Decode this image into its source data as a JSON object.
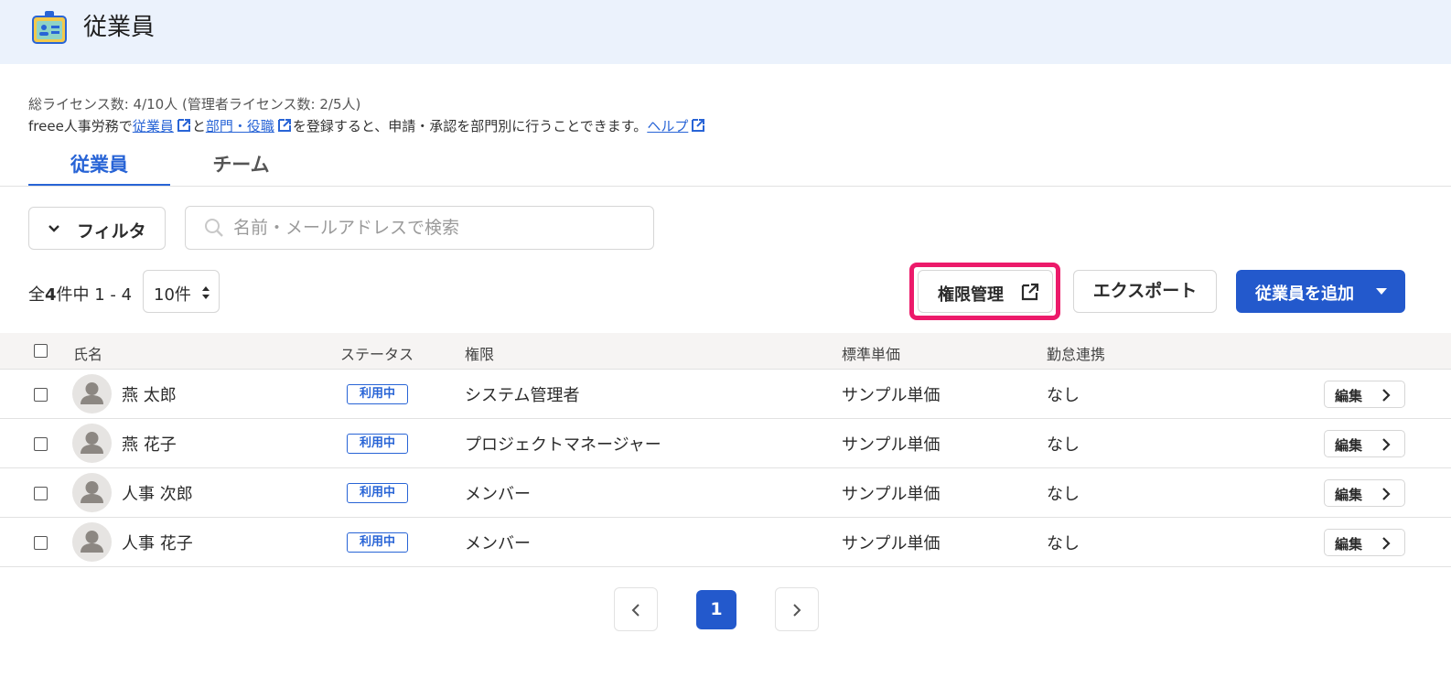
{
  "header": {
    "title": "従業員",
    "icon": "id-badge-icon"
  },
  "info": {
    "license": "総ライセンス数: 4/10人 (管理者ライセンス数: 2/5人)",
    "prefix": "freee人事労務で",
    "link_employees": "従業員",
    "conj": "と",
    "link_departments": "部門・役職",
    "suffix": "を登録すると、申請・承認を部門別に行うことできます。",
    "link_help": "ヘルプ"
  },
  "tabs": [
    {
      "label": "従業員",
      "active": true
    },
    {
      "label": "チーム",
      "active": false
    }
  ],
  "toolbar": {
    "filter_label": "フィルタ",
    "search_placeholder": "名前・メールアドレスで検索",
    "count_prefix": "全",
    "count_total": "4",
    "count_suffix": "件中 1 - 4",
    "per_page": "10件",
    "permissions_label": "権限管理",
    "export_label": "エクスポート",
    "add_label": "従業員を追加"
  },
  "table": {
    "headers": {
      "name": "氏名",
      "status": "ステータス",
      "role": "権限",
      "rate": "標準単価",
      "attendance": "勤怠連携"
    },
    "rows": [
      {
        "name": "燕 太郎",
        "status": "利用中",
        "role": "システム管理者",
        "rate": "サンプル単価",
        "attendance": "なし",
        "edit": "編集"
      },
      {
        "name": "燕 花子",
        "status": "利用中",
        "role": "プロジェクトマネージャー",
        "rate": "サンプル単価",
        "attendance": "なし",
        "edit": "編集"
      },
      {
        "name": "人事 次郎",
        "status": "利用中",
        "role": "メンバー",
        "rate": "サンプル単価",
        "attendance": "なし",
        "edit": "編集"
      },
      {
        "name": "人事 花子",
        "status": "利用中",
        "role": "メンバー",
        "rate": "サンプル単価",
        "attendance": "なし",
        "edit": "編集"
      }
    ]
  },
  "pagination": {
    "current": "1"
  },
  "colors": {
    "primary": "#2359cc",
    "link": "#2864d6",
    "highlight": "#ec1a6a",
    "header_bg": "#ebf2fc"
  }
}
